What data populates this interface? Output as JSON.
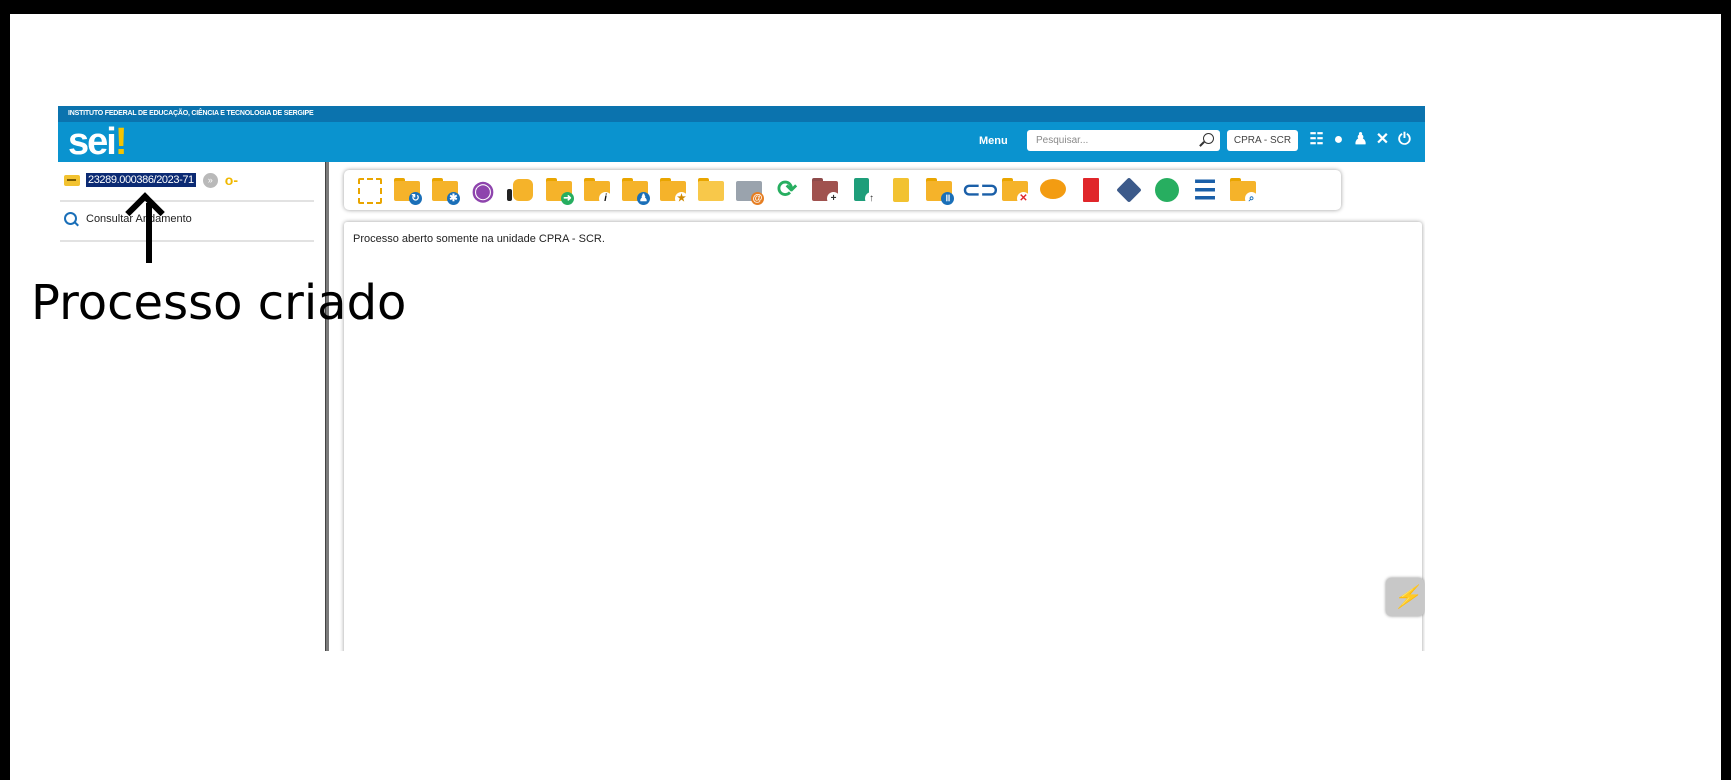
{
  "screenshot": {
    "top_strip": "INSTITUTO FEDERAL DE EDUCAÇÃO, CIÊNCIA E TECNOLOGIA DE SERGIPE",
    "header": {
      "logo": "sei",
      "logo_dot": "!",
      "menu_label": "Menu",
      "search_placeholder": "Pesquisar...",
      "unit": "CPRA - SCR",
      "icons": [
        "grid-icon",
        "alert-icon",
        "user-icon",
        "tools-icon",
        "power-icon"
      ]
    },
    "left_panel": {
      "process_number": "23289.000386/2023-71",
      "consult_label": "Consultar Andamento"
    },
    "toolbar_icons": [
      "new-document-icon",
      "folder-relate-icon",
      "folder-settings-icon",
      "eye-icon",
      "thumb-up-icon",
      "folder-send-icon",
      "folder-info-icon",
      "folder-user-icon",
      "folder-star-icon",
      "folder-open-icon",
      "email-icon",
      "sync-icon",
      "folder-add-icon",
      "building-icon",
      "list-doc-icon",
      "folder-pause-icon",
      "link-icon",
      "folder-remove-icon",
      "comment-icon",
      "trash-icon",
      "tag-icon",
      "clock-icon",
      "list-icon",
      "folder-search-icon"
    ],
    "content_message": "Processo aberto somente na unidade CPRA - SCR."
  },
  "annotation": {
    "label": "Processo criado"
  }
}
